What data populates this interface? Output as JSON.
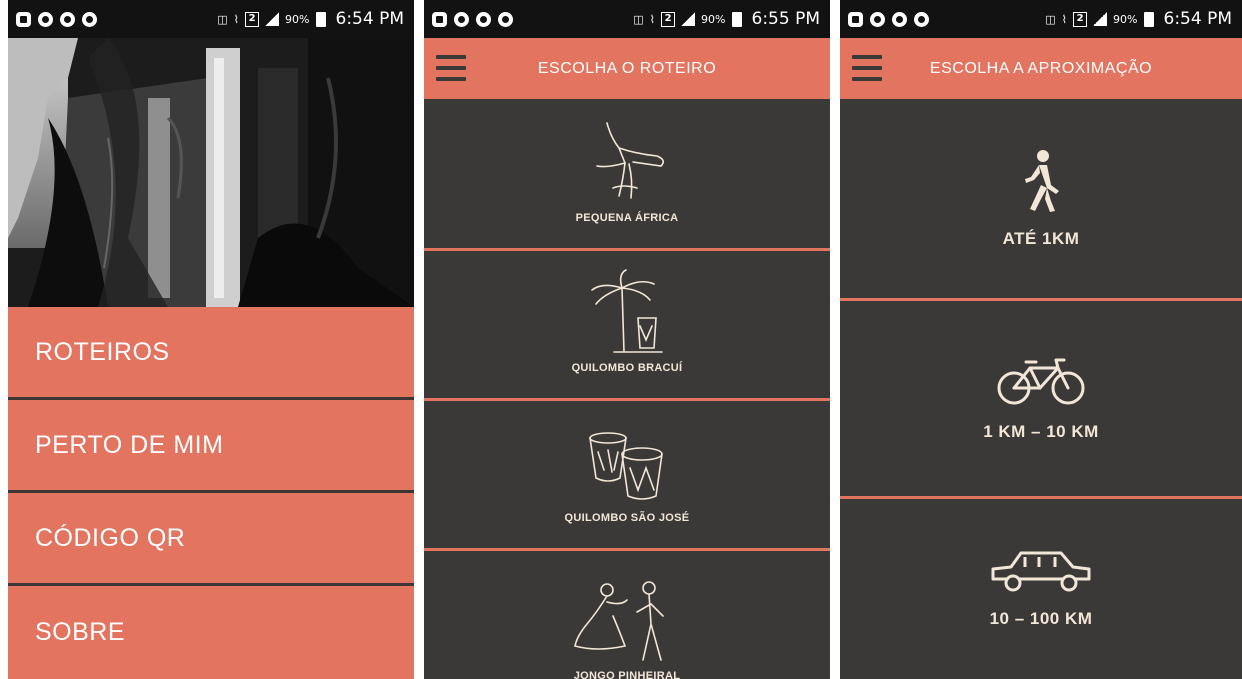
{
  "screens": [
    {
      "status": {
        "battery": "90%",
        "time": "6:54 PM",
        "sim": "2"
      },
      "menu": [
        {
          "label": "ROTEIROS"
        },
        {
          "label": "PERTO DE MIM"
        },
        {
          "label": "CÓDIGO QR"
        },
        {
          "label": "SOBRE"
        }
      ]
    },
    {
      "status": {
        "battery": "90%",
        "time": "6:55 PM",
        "sim": "2"
      },
      "title": "ESCOLHA O ROTEIRO",
      "routes": [
        {
          "label": "PEQUENA ÁFRICA",
          "icon": "capoeira-icon"
        },
        {
          "label": "QUILOMBO BRACUÍ",
          "icon": "palm-drum-icon"
        },
        {
          "label": "QUILOMBO SÃO JOSÉ",
          "icon": "drums-icon"
        },
        {
          "label": "JONGO PINHEIRAL",
          "icon": "dancers-icon"
        }
      ]
    },
    {
      "status": {
        "battery": "90%",
        "time": "6:54 PM",
        "sim": "2"
      },
      "title": "ESCOLHA A APROXIMAÇÃO",
      "approaches": [
        {
          "label": "ATÉ 1KM",
          "icon": "walking-icon"
        },
        {
          "label": "1 KM – 10 KM",
          "icon": "bicycle-icon"
        },
        {
          "label": "10 – 100 KM",
          "icon": "car-icon"
        }
      ]
    }
  ],
  "colors": {
    "accent": "#e37460",
    "dark": "#3a3938",
    "cream": "#f2e6d6",
    "statusbar": "#121212"
  }
}
